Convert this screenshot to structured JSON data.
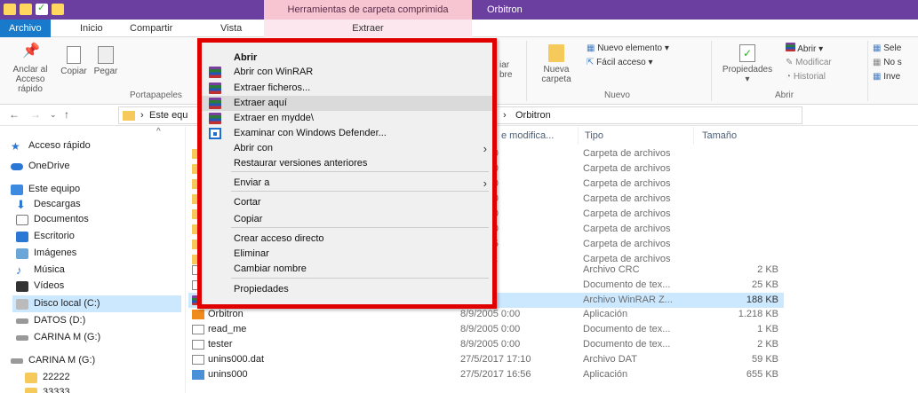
{
  "window": {
    "title": "Orbitron",
    "contextual_tab_group": "Herramientas de carpeta comprimida"
  },
  "tabs": [
    "Archivo",
    "Inicio",
    "Compartir",
    "Vista",
    "Extraer"
  ],
  "ribbon": {
    "pin_label_1": "Anclar al",
    "pin_label_2": "Acceso rápido",
    "copy_label": "Copiar",
    "paste_label": "Pegar",
    "clipboard_group": "Portapapeles",
    "copy_to_label_1": "iar",
    "copy_to_label_2": "bre",
    "new_folder_1": "Nueva",
    "new_folder_2": "carpeta",
    "new_item": "Nuevo elemento ▾",
    "easy_access": "Fácil acceso ▾",
    "new_group": "Nuevo",
    "properties": "Propiedades",
    "open_menu": "Abrir ▾",
    "modify": "Modificar",
    "history": "Historial",
    "open_group": "Abrir",
    "select_1": "Sele",
    "select_2": "No s",
    "select_3": "Inve"
  },
  "address": {
    "crumb_left": "Este equ",
    "crumb_right": "Orbitron"
  },
  "nav_items": [
    "Acceso rápido",
    "OneDrive",
    "Este equipo",
    "Descargas",
    "Documentos",
    "Escritorio",
    "Imágenes",
    "Música",
    "Vídeos",
    "Disco local (C:)",
    "DATOS (D:)",
    "CARINA M (G:)",
    "CARINA M (G:)",
    "22222",
    "33333"
  ],
  "columns": {
    "name": "N",
    "date": "e modifica...",
    "type": "Tipo",
    "size": "Tamaño"
  },
  "files": [
    {
      "name": "",
      "date": "17 17:10",
      "type": "Carpeta de archivos",
      "size": ""
    },
    {
      "name": "",
      "date": "17 17:10",
      "type": "Carpeta de archivos",
      "size": ""
    },
    {
      "name": "",
      "date": "17 17:10",
      "type": "Carpeta de archivos",
      "size": ""
    },
    {
      "name": "",
      "date": "17 17:10",
      "type": "Carpeta de archivos",
      "size": ""
    },
    {
      "name": "",
      "date": "17 17:10",
      "type": "Carpeta de archivos",
      "size": ""
    },
    {
      "name": "",
      "date": "17 17:10",
      "type": "Carpeta de archivos",
      "size": ""
    },
    {
      "name": "",
      "date": "17 23:25",
      "type": "Carpeta de archivos",
      "size": ""
    },
    {
      "name": "",
      "date": "17 17:11",
      "type": "Carpeta de archivos",
      "size": ""
    },
    {
      "name": "",
      "date": "5 0:00",
      "type": "Archivo CRC",
      "size": "2 KB"
    },
    {
      "name": "",
      "date": "5 0:00",
      "type": "Documento de tex...",
      "size": "25 KB"
    },
    {
      "name": "",
      "date": "17 9:30",
      "type": "Archivo WinRAR Z...",
      "size": "188 KB"
    },
    {
      "name": "Orbitron",
      "date": "8/9/2005 0:00",
      "type": "Aplicación",
      "size": "1.218 KB"
    },
    {
      "name": "read_me",
      "date": "8/9/2005 0:00",
      "type": "Documento de tex...",
      "size": "1 KB"
    },
    {
      "name": "tester",
      "date": "8/9/2005 0:00",
      "type": "Documento de tex...",
      "size": "2 KB"
    },
    {
      "name": "unins000.dat",
      "date": "27/5/2017 17:10",
      "type": "Archivo DAT",
      "size": "59 KB"
    },
    {
      "name": "unins000",
      "date": "27/5/2017 16:56",
      "type": "Aplicación",
      "size": "655 KB"
    }
  ],
  "context_menu": [
    {
      "label": "Abrir",
      "bold": true
    },
    {
      "label": "Abrir con WinRAR",
      "icon": "winrar"
    },
    {
      "label": "Extraer ficheros...",
      "icon": "winrar"
    },
    {
      "label": "Extraer aquí",
      "icon": "winrar",
      "highlight": true
    },
    {
      "label": "Extraer en mydde\\",
      "icon": "winrar"
    },
    {
      "label": "Examinar con Windows Defender...",
      "icon": "defender"
    },
    {
      "label": "Abrir con",
      "submenu": true
    },
    {
      "label": "Restaurar versiones anteriores"
    },
    {
      "label": "Enviar a",
      "submenu": true
    },
    {
      "label": "Cortar"
    },
    {
      "label": "Copiar"
    },
    {
      "label": "Crear acceso directo"
    },
    {
      "label": "Eliminar"
    },
    {
      "label": "Cambiar nombre"
    },
    {
      "label": "Propiedades"
    }
  ],
  "colors": {
    "titlebar": "#6b3fa0",
    "file_tab": "#1979ca",
    "context_tab": "#f7c5d1",
    "highlight_border": "#e00000",
    "selection": "#cce8ff"
  }
}
